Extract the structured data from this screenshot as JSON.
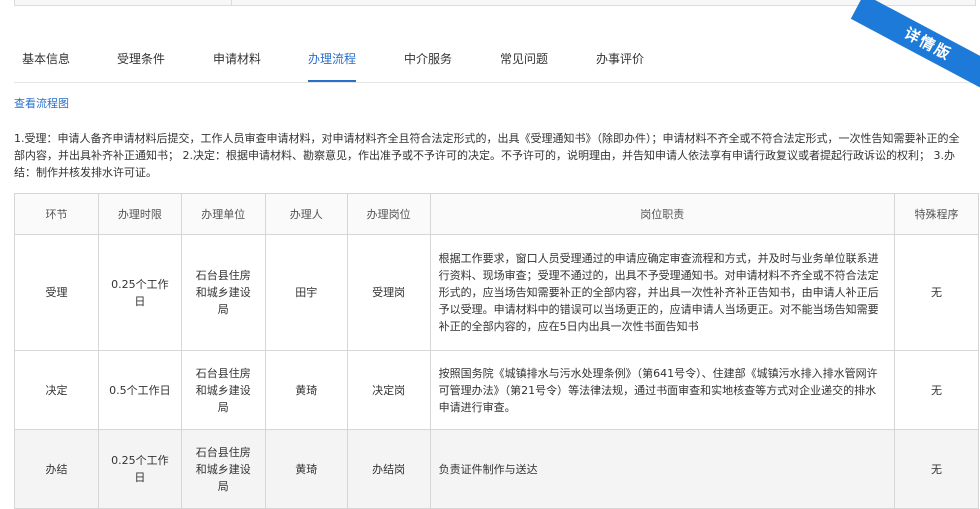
{
  "tabs": [
    {
      "label": "基本信息"
    },
    {
      "label": "受理条件"
    },
    {
      "label": "申请材料"
    },
    {
      "label": "办理流程"
    },
    {
      "label": "中介服务"
    },
    {
      "label": "常见问题"
    },
    {
      "label": "办事评价"
    }
  ],
  "ribbon": {
    "label": "详情版"
  },
  "flow_link": "查看流程图",
  "description": "1.受理：申请人备齐申请材料后提交，工作人员审查申请材料，对申请材料齐全且符合法定形式的，出具《受理通知书》（除即办件）；申请材料不齐全或不符合法定形式，一次性告知需要补正的全部内容，并出具补齐补正通知书； 2.决定：根据申请材料、勘察意见，作出准予或不予许可的决定。不予许可的，说明理由，并告知申请人依法享有申请行政复议或者提起行政诉讼的权利； 3.办结：制作并核发排水许可证。",
  "table": {
    "headers": [
      "环节",
      "办理时限",
      "办理单位",
      "办理人",
      "办理岗位",
      "岗位职责",
      "特殊程序"
    ],
    "rows": [
      {
        "stage": "受理",
        "time": "0.25个工作日",
        "unit": "石台县住房和城乡建设局",
        "person": "田宇",
        "post": "受理岗",
        "duty": "根据工作要求，窗口人员受理通过的申请应确定审查流程和方式，并及时与业务单位联系进行资料、现场审查；受理不通过的，出具不予受理通知书。对申请材料不齐全或不符合法定形式的，应当场告知需要补正的全部内容，并出具一次性补齐补正告知书，由申请人补正后予以受理。申请材料中的错误可以当场更正的，应请申请人当场更正。对不能当场告知需要补正的全部内容的，应在5日内出具一次性书面告知书",
        "special": "无"
      },
      {
        "stage": "决定",
        "time": "0.5个工作日",
        "unit": "石台县住房和城乡建设局",
        "person": "黄琦",
        "post": "决定岗",
        "duty": "按照国务院《城镇排水与污水处理条例》（第641号令）、住建部《城镇污水排入排水管网许可管理办法》（第21号令）等法律法规，通过书面审查和实地核查等方式对企业递交的排水申请进行审查。",
        "special": "无"
      },
      {
        "stage": "办结",
        "time": "0.25个工作日",
        "unit": "石台县住房和城乡建设局",
        "person": "黄琦",
        "post": "办结岗",
        "duty": "负责证件制作与送达",
        "special": "无"
      }
    ]
  }
}
